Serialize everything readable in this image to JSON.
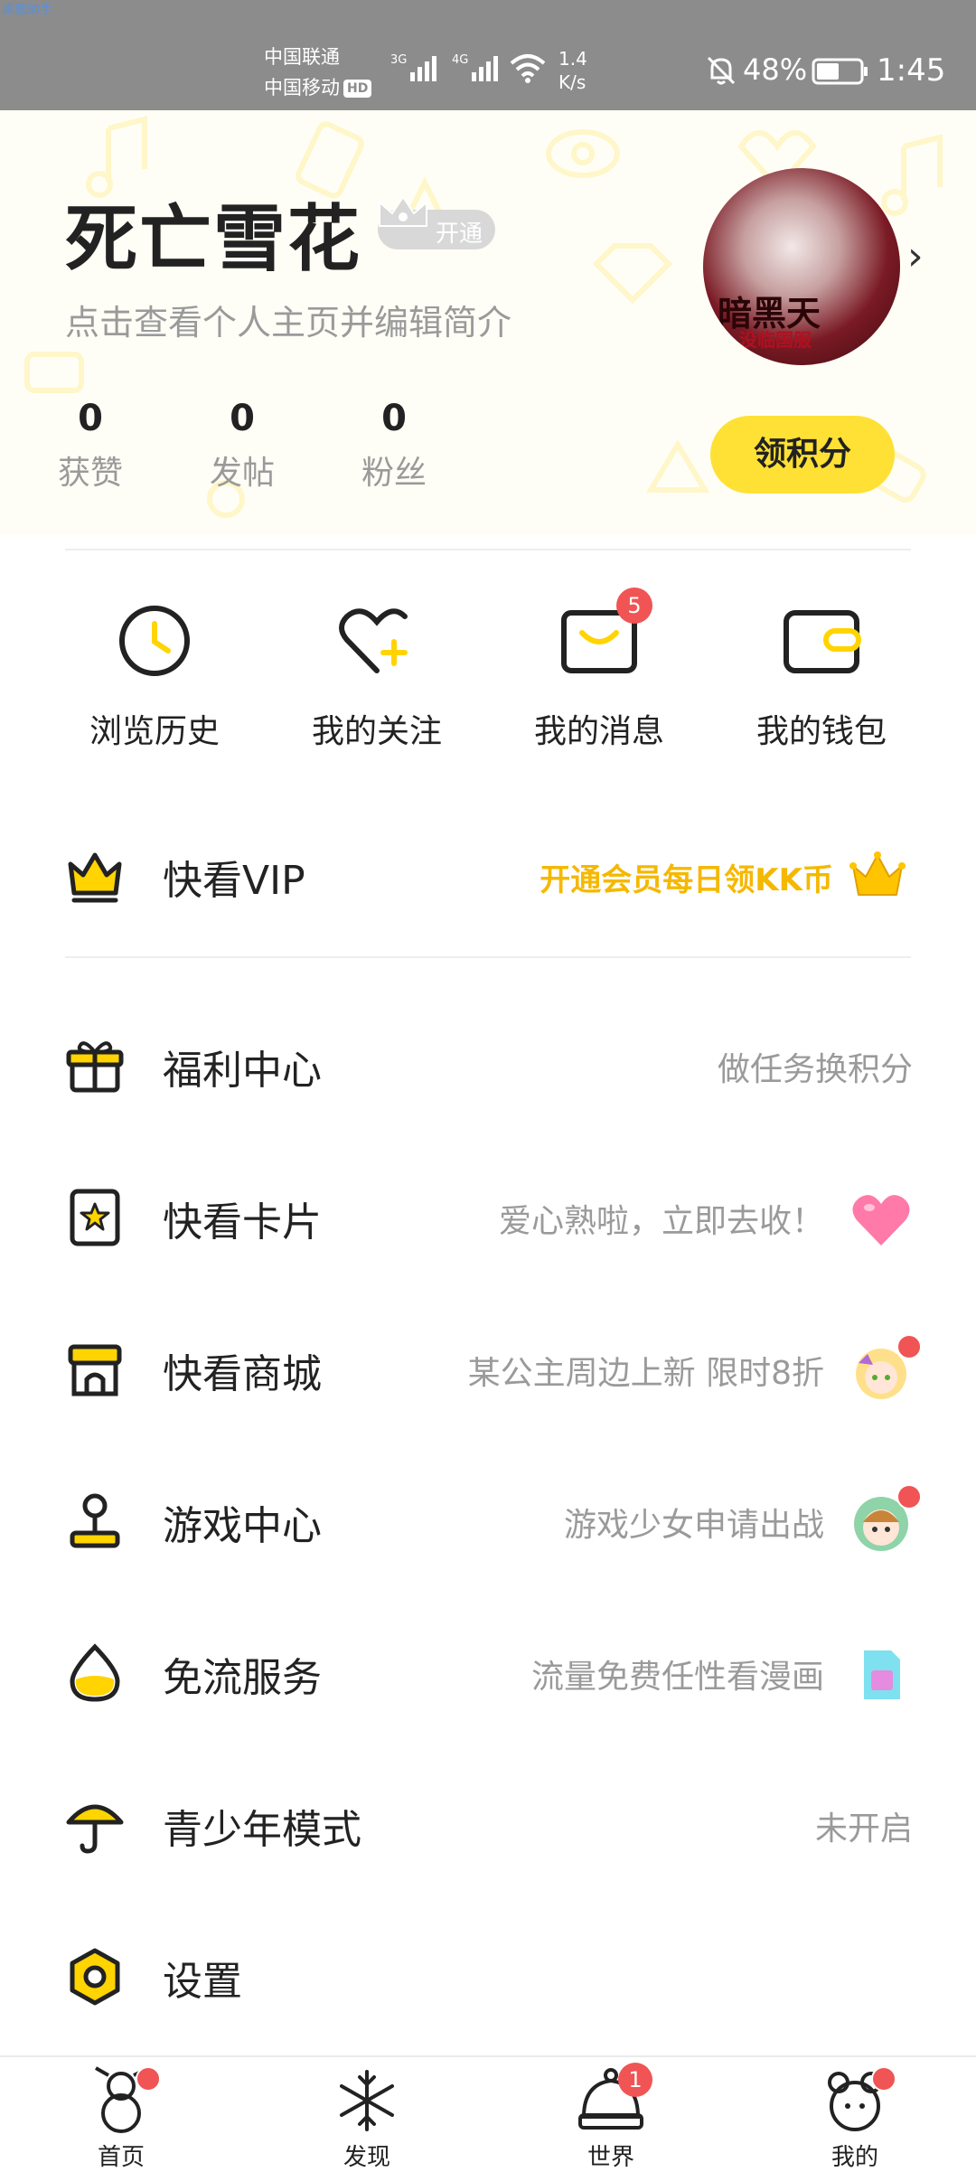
{
  "status_bar": {
    "tiny_label": "桌面助手",
    "carrier1": "中国联通",
    "carrier2": "中国移动",
    "hd": "HD",
    "sig1": "3G",
    "sig2": "4G",
    "net_speed_value": "1.4",
    "net_speed_unit": "K/s",
    "battery": "48%",
    "time": "1:45"
  },
  "profile": {
    "username": "死亡雪花",
    "vip_pill": "开通",
    "subtitle": "点击查看个人主页并编辑简介",
    "avatar_text": "暗黑天",
    "avatar_subtext": "没临国服",
    "stats": [
      {
        "value": "0",
        "label": "获赞"
      },
      {
        "value": "0",
        "label": "发帖"
      },
      {
        "value": "0",
        "label": "粉丝"
      }
    ],
    "points_button": "领积分"
  },
  "quick_actions": [
    {
      "label": "浏览历史",
      "icon": "clock-icon"
    },
    {
      "label": "我的关注",
      "icon": "heart-plus-icon"
    },
    {
      "label": "我的消息",
      "icon": "message-icon",
      "badge": "5"
    },
    {
      "label": "我的钱包",
      "icon": "wallet-icon"
    }
  ],
  "vip_row": {
    "title": "快看VIP",
    "hint": "开通会员每日领KK币"
  },
  "menu": [
    {
      "title": "福利中心",
      "hint": "做任务换积分",
      "icon": "gift-icon"
    },
    {
      "title": "快看卡片",
      "hint": "爱心熟啦，立即去收！",
      "icon": "card-star-icon"
    },
    {
      "title": "快看商城",
      "hint": "某公主周边上新 限时8折",
      "icon": "shop-icon"
    },
    {
      "title": "游戏中心",
      "hint": "游戏少女申请出战",
      "icon": "joystick-icon"
    },
    {
      "title": "免流服务",
      "hint": "流量免费任性看漫画",
      "icon": "droplet-icon"
    },
    {
      "title": "青少年模式",
      "hint": "未开启",
      "icon": "umbrella-icon"
    },
    {
      "title": "设置",
      "hint": "",
      "icon": "gear-icon"
    }
  ],
  "bottom_nav": [
    {
      "label": "首页",
      "icon": "snowman-icon"
    },
    {
      "label": "发现",
      "icon": "snowflake-icon"
    },
    {
      "label": "世界",
      "icon": "hat-icon",
      "badge": "1"
    },
    {
      "label": "我的",
      "icon": "character-icon"
    }
  ],
  "colors": {
    "accent_yellow": "#ffe135",
    "vip_gold": "#f5b800",
    "badge_red": "#f05454",
    "hint_gray": "#9a9a9a"
  }
}
